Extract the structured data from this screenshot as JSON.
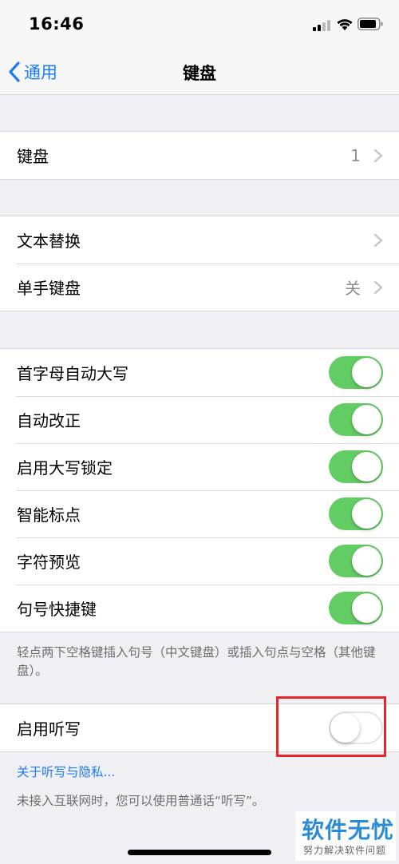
{
  "status_bar": {
    "time": "16:46",
    "icons": [
      "signal-icon",
      "wifi-icon",
      "battery-icon"
    ]
  },
  "nav": {
    "back_label": "通用",
    "title": "键盘"
  },
  "sections": {
    "keyboards": {
      "label": "键盘",
      "value": "1"
    },
    "text_replacement": {
      "label": "文本替换"
    },
    "one_handed": {
      "label": "单手键盘",
      "value": "关"
    },
    "toggles": [
      {
        "label": "首字母自动大写",
        "on": true
      },
      {
        "label": "自动改正",
        "on": true
      },
      {
        "label": "启用大写锁定",
        "on": true
      },
      {
        "label": "智能标点",
        "on": true
      },
      {
        "label": "字符预览",
        "on": true
      },
      {
        "label": "句号快捷键",
        "on": true
      }
    ],
    "period_note": "轻点两下空格键插入句号（中文键盘）或插入句点与空格（其他键盘）。",
    "dictation": {
      "label": "启用听写",
      "on": false
    },
    "privacy_link": "关于听写与隐私...",
    "dictation_note": "未接入互联网时，您可以使用普通话“听写”。"
  },
  "colors": {
    "accent": "#1a7cf5",
    "toggle_on": "#62cd63",
    "highlight": "#e8262c",
    "background": "#efeff4"
  },
  "watermark": {
    "main": "软件无忧",
    "sub": "努力解决软件问题"
  }
}
